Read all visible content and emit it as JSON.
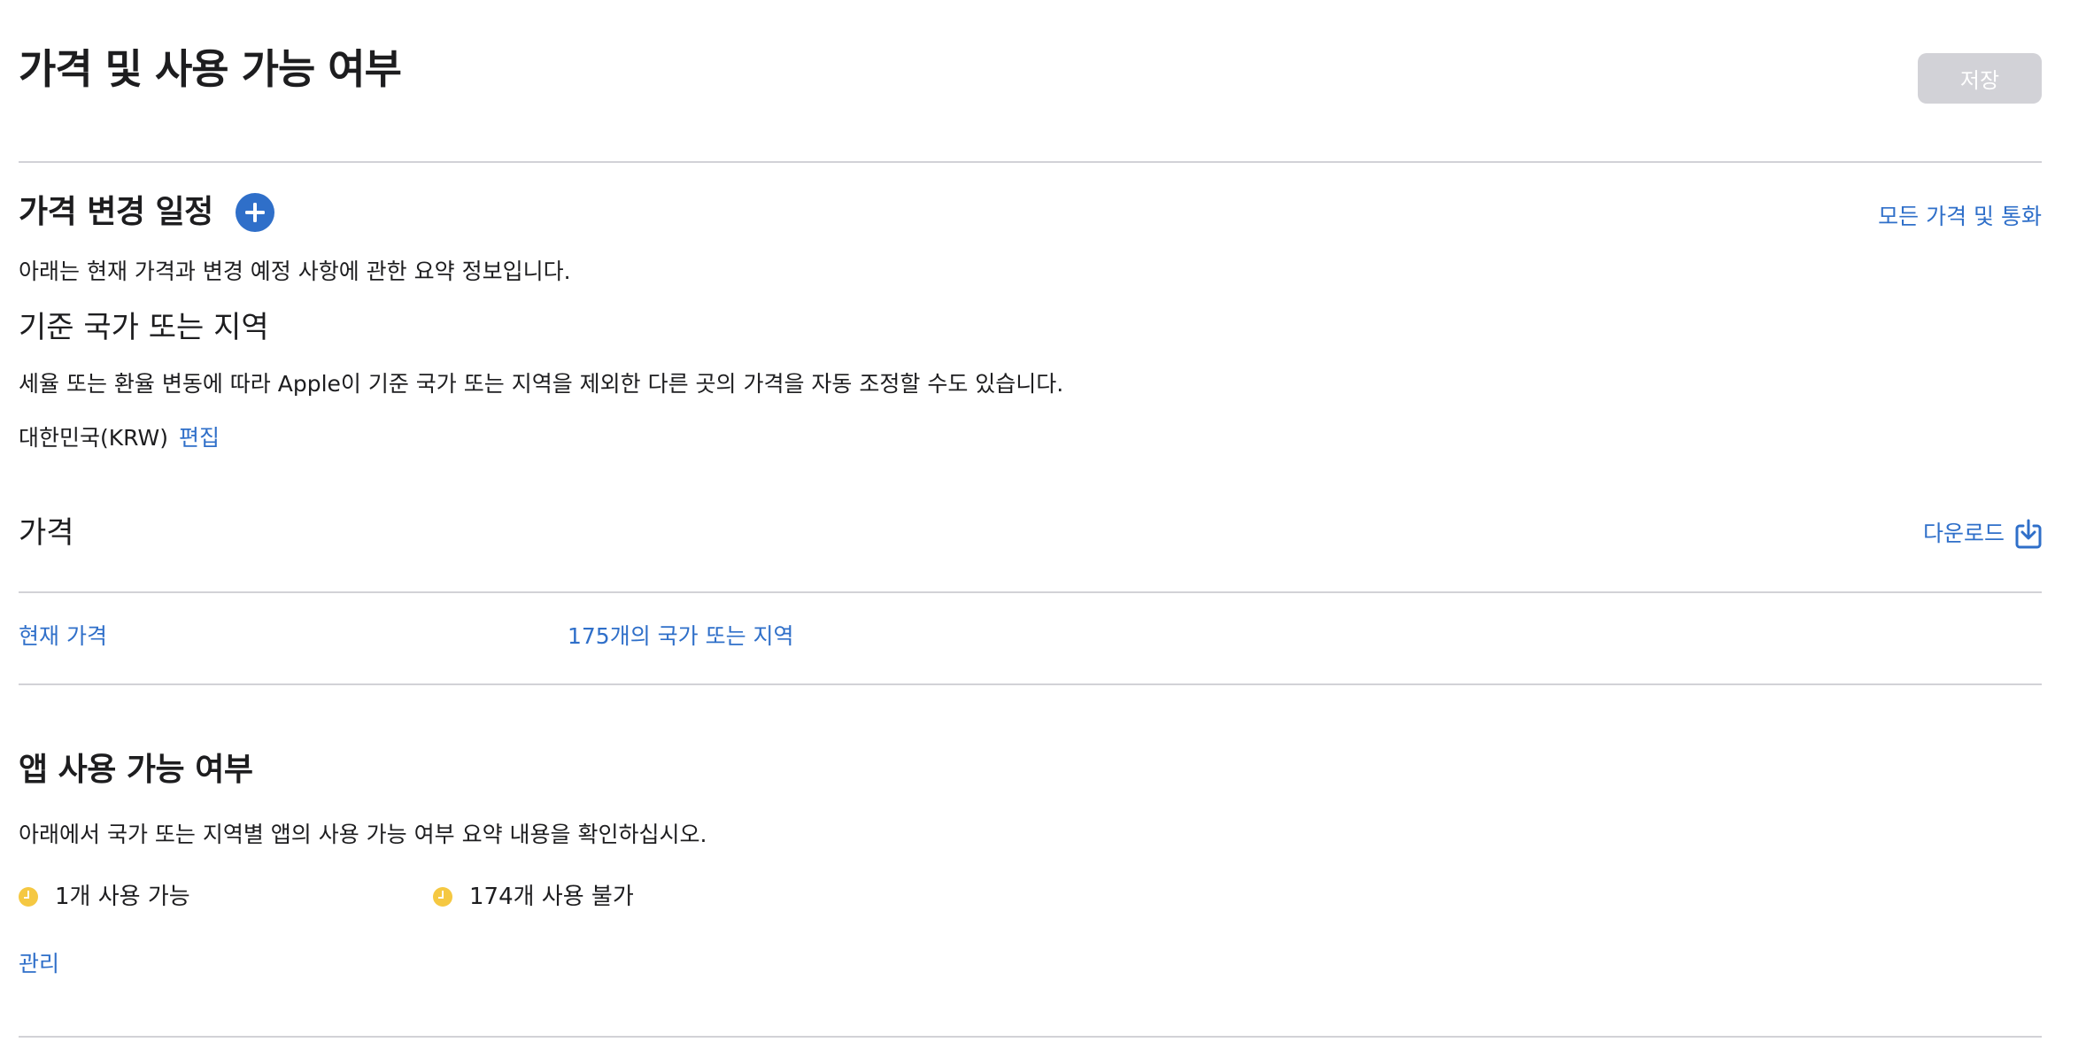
{
  "header": {
    "title": "가격 및 사용 가능 여부",
    "save_label": "저장"
  },
  "price_schedule": {
    "title": "가격 변경 일정",
    "all_prices_link": "모든 가격 및 통화",
    "description": "아래는 현재 가격과 변경 예정 사항에 관한 요약 정보입니다."
  },
  "base_region": {
    "title": "기준 국가 또는 지역",
    "description": "세율 또는 환율 변동에 따라 Apple이 기준 국가 또는 지역을 제외한 다른 곳의 가격을 자동 조정할 수도 있습니다.",
    "current_value": "대한민국(KRW)",
    "edit_label": "편집"
  },
  "price": {
    "title": "가격",
    "download_label": "다운로드",
    "rows": [
      {
        "label": "현재 가격",
        "value": "175개의 국가 또는 지역"
      }
    ]
  },
  "availability": {
    "title": "앱 사용 가능 여부",
    "description": "아래에서 국가 또는 지역별 앱의 사용 가능 여부 요약 내용을 확인하십시오.",
    "statuses": [
      {
        "label": "1개 사용 가능",
        "icon": "clock-icon",
        "color": "#f5c842"
      },
      {
        "label": "174개 사용 불가",
        "icon": "clock-icon",
        "color": "#f5c842"
      }
    ],
    "manage_label": "관리"
  },
  "colors": {
    "accent": "#2f6fc9",
    "divider": "#d2d2d7",
    "disabled_button": "#d2d2d7",
    "pending_status": "#f5c842"
  }
}
